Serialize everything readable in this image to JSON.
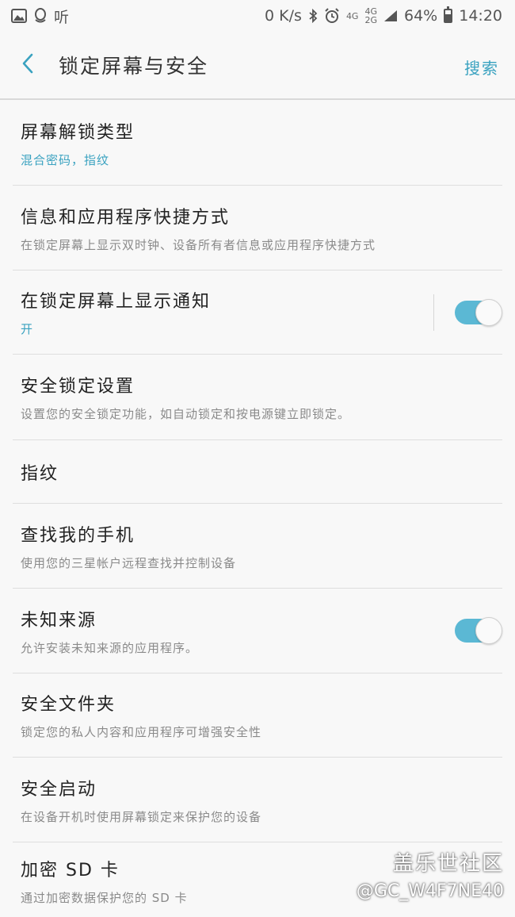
{
  "status_bar": {
    "left_icons": [
      "image-icon",
      "qq-icon"
    ],
    "left_text": "听",
    "net_speed": "0 K/s",
    "signal_a": "4G",
    "signal_b_top": "4G",
    "signal_b_bottom": "2G",
    "battery": "64%",
    "battery_level": 0.64,
    "time": "14:20"
  },
  "app_bar": {
    "title": "锁定屏幕与安全",
    "search_label": "搜索"
  },
  "items": [
    {
      "title": "屏幕解锁类型",
      "subtitle": "混合密码，指纹"
    },
    {
      "title": "信息和应用程序快捷方式",
      "subtitle": "在锁定屏幕上显示双时钟、设备所有者信息或应用程序快捷方式"
    },
    {
      "title": "在锁定屏幕上显示通知",
      "subtitle": "开",
      "toggle_on": true
    },
    {
      "title": "安全锁定设置",
      "subtitle": "设置您的安全锁定功能，如自动锁定和按电源键立即锁定。"
    },
    {
      "title": "指纹"
    },
    {
      "title": "查找我的手机",
      "subtitle": "使用您的三星帐户远程查找并控制设备"
    },
    {
      "title": "未知来源",
      "subtitle": "允许安装未知来源的应用程序。",
      "toggle_on": true
    },
    {
      "title": "安全文件夹",
      "subtitle": "锁定您的私人内容和应用程序可增强安全性"
    },
    {
      "title": "安全启动",
      "subtitle": "在设备开机时使用屏幕锁定来保护您的设备"
    },
    {
      "title": "加密 SD 卡",
      "subtitle": "通过加密数据保护您的 SD 卡"
    }
  ],
  "watermark": {
    "line1": "盖乐世社区",
    "line2": "@GC_W4F7NE40"
  },
  "colors": {
    "accent": "#3aa2c0",
    "toggle_track": "#5bb8d4",
    "background": "#f8f8f8"
  }
}
